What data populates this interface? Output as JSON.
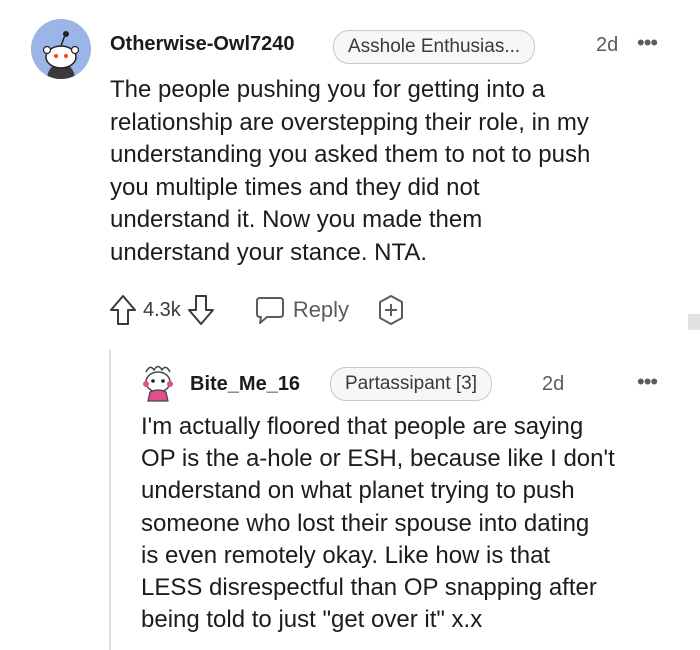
{
  "comment": {
    "username": "Otherwise-Owl7240",
    "flair": "Asshole Enthusias...",
    "time": "2d",
    "more": "•••",
    "body": "The people pushing you for getting into a\nrelationship are overstepping their role, in my\nunderstanding you asked them to not to push\nyou multiple times and they did not\nunderstand it. Now you made them\nunderstand your stance. NTA.",
    "vote_count": "4.3k",
    "reply_label": "Reply",
    "icons": [
      "upvote-icon",
      "downvote-icon",
      "comment-bubble-icon",
      "award-plus-icon"
    ],
    "avatar_color": "#9bb5e6"
  },
  "reply": {
    "username": "Bite_Me_16",
    "flair": "Partassipant [3]",
    "time": "2d",
    "more": "•••",
    "body": "I'm actually floored that people are saying\nOP is the a-hole or ESH, because like I don't\nunderstand on what planet trying to push\nsomeone who lost their spouse into dating\nis even remotely okay. Like how is that\nLESS disrespectful than OP snapping after\nbeing told to just \"get over it\" x.x",
    "avatar_accent": "#e0508c"
  }
}
